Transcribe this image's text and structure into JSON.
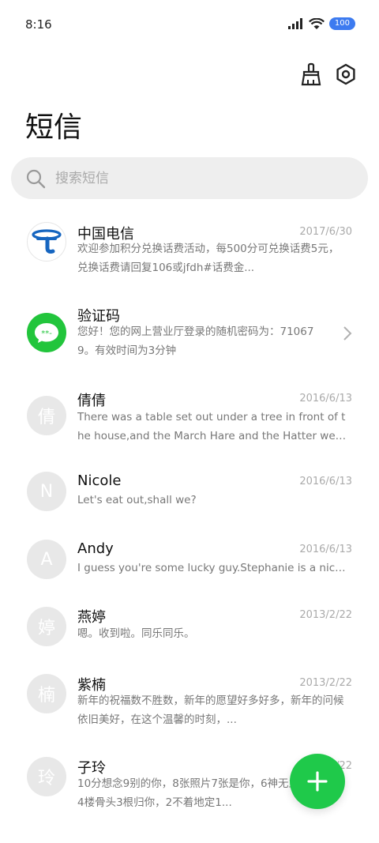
{
  "status": {
    "time": "8:16",
    "battery": "100"
  },
  "header": {
    "title": "短信",
    "clean_icon": "broom-icon",
    "settings_icon": "settings-icon"
  },
  "search": {
    "placeholder": "搜索短信"
  },
  "messages": [
    {
      "sender": "中国电信",
      "date": "2017/6/30",
      "avatar_type": "logo",
      "avatar_letter": "",
      "preview": "欢迎参加积分兑换话费活动，每500分可兑换话费5元，兑换话费请回复106或jfdh#话费金..."
    },
    {
      "sender": "验证码",
      "date": "",
      "avatar_type": "chat-icon",
      "avatar_letter": "",
      "preview": "您好！您的网上营业厅登录的随机密码为：710679。有效时间为3分钟"
    },
    {
      "sender": "倩倩",
      "date": "2016/6/13",
      "avatar_type": "letter",
      "avatar_letter": "倩",
      "preview": "There was a table set out under a tree in front of the house,and the March Hare and the Hatter were ..."
    },
    {
      "sender": "Nicole",
      "date": "2016/6/13",
      "avatar_type": "letter",
      "avatar_letter": "N",
      "preview": "Let's eat out,shall we?"
    },
    {
      "sender": "Andy",
      "date": "2016/6/13",
      "avatar_type": "letter",
      "avatar_letter": "A",
      "preview": "I guess you're some lucky guy.Stephanie is a nice girl."
    },
    {
      "sender": "燕婷",
      "date": "2013/2/22",
      "avatar_type": "letter",
      "avatar_letter": "婷",
      "preview": "嗯。收到啦。同乐同乐。"
    },
    {
      "sender": "紫楠",
      "date": "2013/2/22",
      "avatar_type": "letter",
      "avatar_letter": "楠",
      "preview": "新年的祝福数不胜数，新年的愿望好多好多，新年的问候依旧美好，在这个温馨的时刻，..."
    },
    {
      "sender": "子玲",
      "date": "2013/2/22",
      "avatar_type": "letter",
      "avatar_letter": "玲",
      "preview": "10分想念9别的你，8张照片7张是你，6神无主只像你，4楼骨头3根归你，2不着地定1..."
    }
  ],
  "fab": {
    "icon": "plus-icon"
  }
}
